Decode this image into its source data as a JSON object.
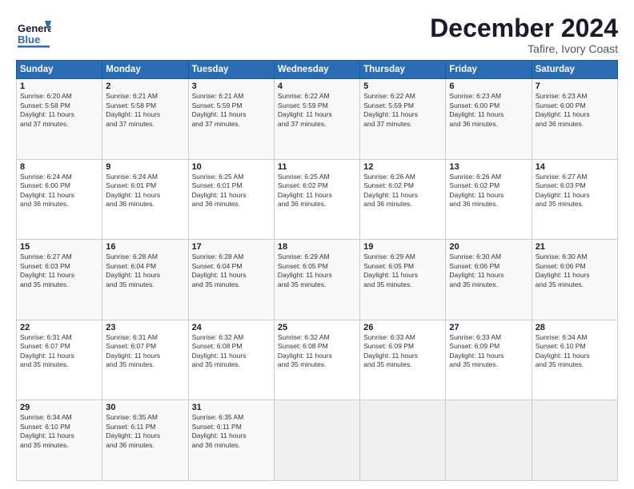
{
  "header": {
    "logo_general": "General",
    "logo_blue": "Blue",
    "main_title": "December 2024",
    "subtitle": "Tafire, Ivory Coast"
  },
  "calendar": {
    "days_of_week": [
      "Sunday",
      "Monday",
      "Tuesday",
      "Wednesday",
      "Thursday",
      "Friday",
      "Saturday"
    ],
    "weeks": [
      [
        {
          "day": "1",
          "lines": [
            "Sunrise: 6:20 AM",
            "Sunset: 5:58 PM",
            "Daylight: 11 hours",
            "and 37 minutes."
          ]
        },
        {
          "day": "2",
          "lines": [
            "Sunrise: 6:21 AM",
            "Sunset: 5:58 PM",
            "Daylight: 11 hours",
            "and 37 minutes."
          ]
        },
        {
          "day": "3",
          "lines": [
            "Sunrise: 6:21 AM",
            "Sunset: 5:59 PM",
            "Daylight: 11 hours",
            "and 37 minutes."
          ]
        },
        {
          "day": "4",
          "lines": [
            "Sunrise: 6:22 AM",
            "Sunset: 5:59 PM",
            "Daylight: 11 hours",
            "and 37 minutes."
          ]
        },
        {
          "day": "5",
          "lines": [
            "Sunrise: 6:22 AM",
            "Sunset: 5:59 PM",
            "Daylight: 11 hours",
            "and 37 minutes."
          ]
        },
        {
          "day": "6",
          "lines": [
            "Sunrise: 6:23 AM",
            "Sunset: 6:00 PM",
            "Daylight: 11 hours",
            "and 36 minutes."
          ]
        },
        {
          "day": "7",
          "lines": [
            "Sunrise: 6:23 AM",
            "Sunset: 6:00 PM",
            "Daylight: 11 hours",
            "and 36 minutes."
          ]
        }
      ],
      [
        {
          "day": "8",
          "lines": [
            "Sunrise: 6:24 AM",
            "Sunset: 6:00 PM",
            "Daylight: 11 hours",
            "and 36 minutes."
          ]
        },
        {
          "day": "9",
          "lines": [
            "Sunrise: 6:24 AM",
            "Sunset: 6:01 PM",
            "Daylight: 11 hours",
            "and 36 minutes."
          ]
        },
        {
          "day": "10",
          "lines": [
            "Sunrise: 6:25 AM",
            "Sunset: 6:01 PM",
            "Daylight: 11 hours",
            "and 36 minutes."
          ]
        },
        {
          "day": "11",
          "lines": [
            "Sunrise: 6:25 AM",
            "Sunset: 6:02 PM",
            "Daylight: 11 hours",
            "and 36 minutes."
          ]
        },
        {
          "day": "12",
          "lines": [
            "Sunrise: 6:26 AM",
            "Sunset: 6:02 PM",
            "Daylight: 11 hours",
            "and 36 minutes."
          ]
        },
        {
          "day": "13",
          "lines": [
            "Sunrise: 6:26 AM",
            "Sunset: 6:02 PM",
            "Daylight: 11 hours",
            "and 36 minutes."
          ]
        },
        {
          "day": "14",
          "lines": [
            "Sunrise: 6:27 AM",
            "Sunset: 6:03 PM",
            "Daylight: 11 hours",
            "and 35 minutes."
          ]
        }
      ],
      [
        {
          "day": "15",
          "lines": [
            "Sunrise: 6:27 AM",
            "Sunset: 6:03 PM",
            "Daylight: 11 hours",
            "and 35 minutes."
          ]
        },
        {
          "day": "16",
          "lines": [
            "Sunrise: 6:28 AM",
            "Sunset: 6:04 PM",
            "Daylight: 11 hours",
            "and 35 minutes."
          ]
        },
        {
          "day": "17",
          "lines": [
            "Sunrise: 6:28 AM",
            "Sunset: 6:04 PM",
            "Daylight: 11 hours",
            "and 35 minutes."
          ]
        },
        {
          "day": "18",
          "lines": [
            "Sunrise: 6:29 AM",
            "Sunset: 6:05 PM",
            "Daylight: 11 hours",
            "and 35 minutes."
          ]
        },
        {
          "day": "19",
          "lines": [
            "Sunrise: 6:29 AM",
            "Sunset: 6:05 PM",
            "Daylight: 11 hours",
            "and 35 minutes."
          ]
        },
        {
          "day": "20",
          "lines": [
            "Sunrise: 6:30 AM",
            "Sunset: 6:06 PM",
            "Daylight: 11 hours",
            "and 35 minutes."
          ]
        },
        {
          "day": "21",
          "lines": [
            "Sunrise: 6:30 AM",
            "Sunset: 6:06 PM",
            "Daylight: 11 hours",
            "and 35 minutes."
          ]
        }
      ],
      [
        {
          "day": "22",
          "lines": [
            "Sunrise: 6:31 AM",
            "Sunset: 6:07 PM",
            "Daylight: 11 hours",
            "and 35 minutes."
          ]
        },
        {
          "day": "23",
          "lines": [
            "Sunrise: 6:31 AM",
            "Sunset: 6:07 PM",
            "Daylight: 11 hours",
            "and 35 minutes."
          ]
        },
        {
          "day": "24",
          "lines": [
            "Sunrise: 6:32 AM",
            "Sunset: 6:08 PM",
            "Daylight: 11 hours",
            "and 35 minutes."
          ]
        },
        {
          "day": "25",
          "lines": [
            "Sunrise: 6:32 AM",
            "Sunset: 6:08 PM",
            "Daylight: 11 hours",
            "and 35 minutes."
          ]
        },
        {
          "day": "26",
          "lines": [
            "Sunrise: 6:33 AM",
            "Sunset: 6:09 PM",
            "Daylight: 11 hours",
            "and 35 minutes."
          ]
        },
        {
          "day": "27",
          "lines": [
            "Sunrise: 6:33 AM",
            "Sunset: 6:09 PM",
            "Daylight: 11 hours",
            "and 35 minutes."
          ]
        },
        {
          "day": "28",
          "lines": [
            "Sunrise: 6:34 AM",
            "Sunset: 6:10 PM",
            "Daylight: 11 hours",
            "and 35 minutes."
          ]
        }
      ],
      [
        {
          "day": "29",
          "lines": [
            "Sunrise: 6:34 AM",
            "Sunset: 6:10 PM",
            "Daylight: 11 hours",
            "and 35 minutes."
          ]
        },
        {
          "day": "30",
          "lines": [
            "Sunrise: 6:35 AM",
            "Sunset: 6:11 PM",
            "Daylight: 11 hours",
            "and 36 minutes."
          ]
        },
        {
          "day": "31",
          "lines": [
            "Sunrise: 6:35 AM",
            "Sunset: 6:11 PM",
            "Daylight: 11 hours",
            "and 36 minutes."
          ]
        },
        {
          "day": "",
          "lines": []
        },
        {
          "day": "",
          "lines": []
        },
        {
          "day": "",
          "lines": []
        },
        {
          "day": "",
          "lines": []
        }
      ]
    ]
  }
}
